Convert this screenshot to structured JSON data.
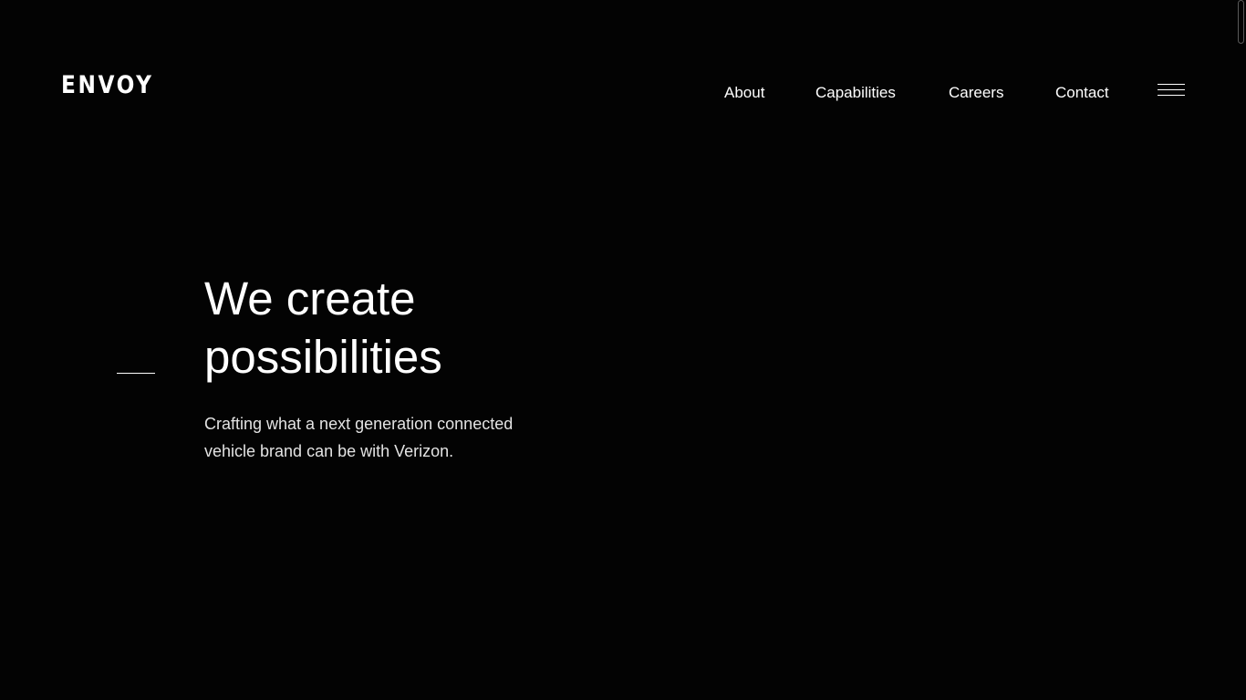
{
  "header": {
    "logo_text": "ENVOY",
    "nav": {
      "about": "About",
      "capabilities": "Capabilities",
      "careers": "Careers",
      "contact": "Contact"
    },
    "menu_icon": "hamburger-icon"
  },
  "hero": {
    "headline_line1": "We create",
    "headline_line2": "possibilities",
    "subtext_line1": "Crafting what a next generation connected",
    "subtext_line2": "vehicle brand can be with Verizon."
  },
  "colors": {
    "background": "#030303",
    "text": "#ffffff",
    "subtext": "#e3e3e3"
  }
}
